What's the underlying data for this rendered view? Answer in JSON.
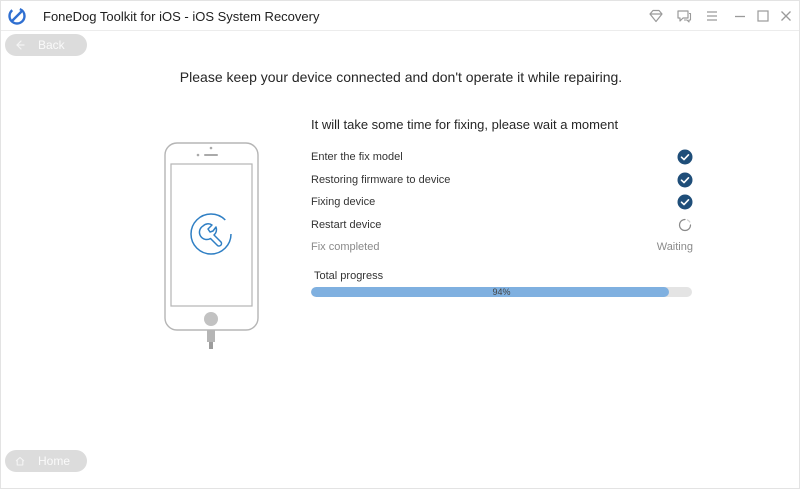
{
  "app": {
    "title": "FoneDog Toolkit for iOS - iOS System Recovery",
    "brand_color": "#2f6fd1"
  },
  "titlebar_icons": [
    "diamond-icon",
    "chat-icon",
    "menu-icon",
    "minimize-icon",
    "maximize-icon",
    "close-icon"
  ],
  "nav": {
    "back_label": "Back",
    "home_label": "Home"
  },
  "main": {
    "heading": "Please keep your device connected and don't operate it while repairing.",
    "subheading": "It will take some time for fixing, please wait a moment"
  },
  "steps": [
    {
      "label": "Enter the fix model",
      "status": "done"
    },
    {
      "label": "Restoring firmware to device",
      "status": "done"
    },
    {
      "label": "Fixing device",
      "status": "done"
    },
    {
      "label": "Restart device",
      "status": "in-progress"
    },
    {
      "label": "Fix completed",
      "status": "waiting",
      "status_text": "Waiting"
    }
  ],
  "progress": {
    "label": "Total progress",
    "percent": 94,
    "percent_text": "94%",
    "fill_color": "#7fb0e0"
  },
  "colors": {
    "check": "#1f4e79",
    "phone_outline": "#b5b5b5",
    "wrench_accent": "#2f7fc4"
  }
}
